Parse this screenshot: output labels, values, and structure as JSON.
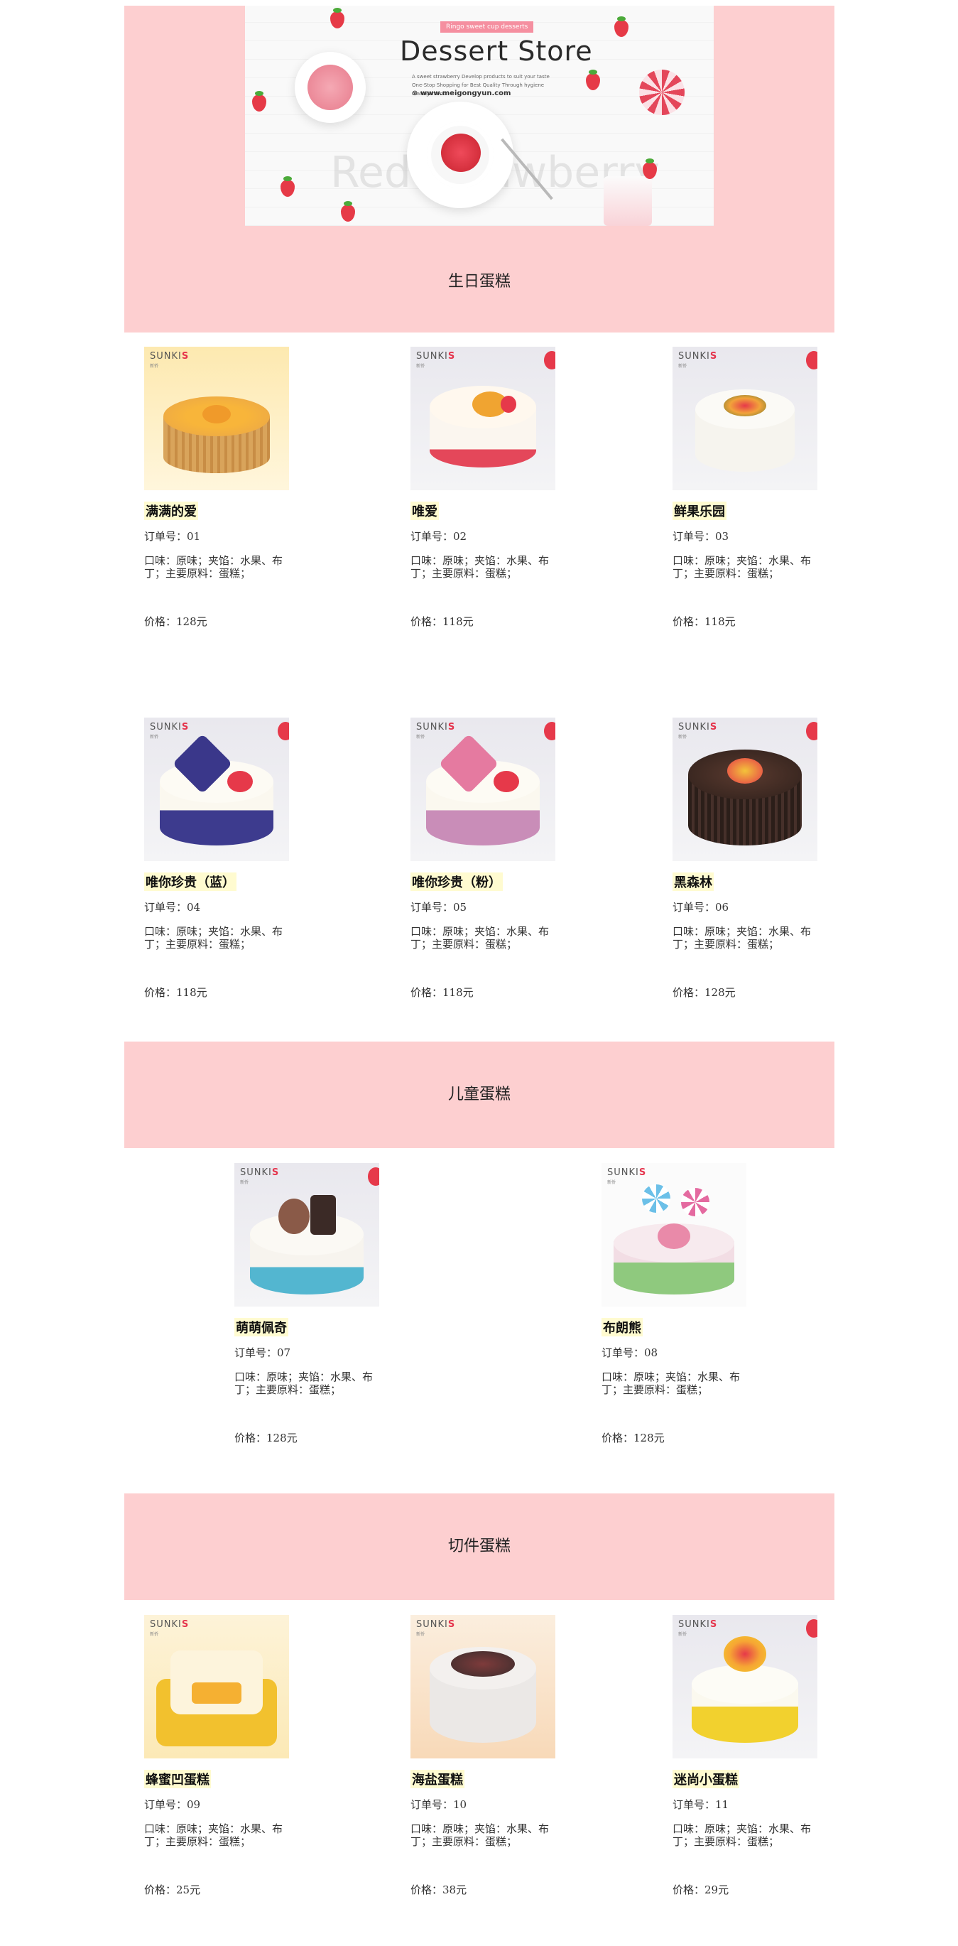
{
  "banner": {
    "badge": "Ringo sweet cup desserts",
    "title": "Dessert Store",
    "subtitle": "A sweet strawberry Develop products to suit your taste One-Stop Shopping for Best Quality Through hygiene management",
    "url": "www.meigongyun.com",
    "watermark": "Red Strawberry"
  },
  "sections": [
    {
      "title": "生日蛋糕"
    },
    {
      "title": "儿童蛋糕"
    },
    {
      "title": "切件蛋糕"
    }
  ],
  "logo": {
    "brand_main": "SUNKI",
    "brand_s": "S",
    "brand_sub": "新侨"
  },
  "products": [
    {
      "name": "满满的爱",
      "order": "订单号：01",
      "desc": "口味：原味；夹馅：水果、布丁；主要原料：蛋糕；",
      "price": "价格：128元"
    },
    {
      "name": "唯爱",
      "order": "订单号：02",
      "desc": "口味：原味；夹馅：水果、布丁；主要原料：蛋糕；",
      "price": "价格：118元"
    },
    {
      "name": "鲜果乐园",
      "order": "订单号：03",
      "desc": "口味：原味；夹馅：水果、布丁；主要原料：蛋糕；",
      "price": "价格：118元"
    },
    {
      "name": "唯你珍贵（蓝）",
      "order": "订单号：04",
      "desc": "口味：原味；夹馅：水果、布丁；主要原料：蛋糕；",
      "price": "价格：118元"
    },
    {
      "name": "唯你珍贵（粉）",
      "order": "订单号：05",
      "desc": "口味：原味；夹馅：水果、布丁；主要原料：蛋糕；",
      "price": "价格：118元"
    },
    {
      "name": "黑森林",
      "order": "订单号：06",
      "desc": "口味：原味；夹馅：水果、布丁；主要原料：蛋糕；",
      "price": "价格：128元"
    },
    {
      "name": "萌萌佩奇",
      "order": "订单号：07",
      "desc": "口味：原味；夹馅：水果、布丁；主要原料：蛋糕；",
      "price": "价格：128元"
    },
    {
      "name": "布朗熊",
      "order": "订单号：08",
      "desc": "口味：原味；夹馅：水果、布丁；主要原料：蛋糕；",
      "price": "价格：128元"
    },
    {
      "name": "蜂蜜凹蛋糕",
      "order": "订单号：09",
      "desc": "口味：原味；夹馅：水果、布丁；主要原料：蛋糕；",
      "price": "价格：25元"
    },
    {
      "name": "海盐蛋糕",
      "order": "订单号：10",
      "desc": "口味：原味；夹馅：水果、布丁；主要原料：蛋糕；",
      "price": "价格：38元"
    },
    {
      "name": "迷尚小蛋糕",
      "order": "订单号：11",
      "desc": "口味：原味；夹馅：水果、布丁；主要原料：蛋糕；",
      "price": "价格：29元"
    }
  ]
}
